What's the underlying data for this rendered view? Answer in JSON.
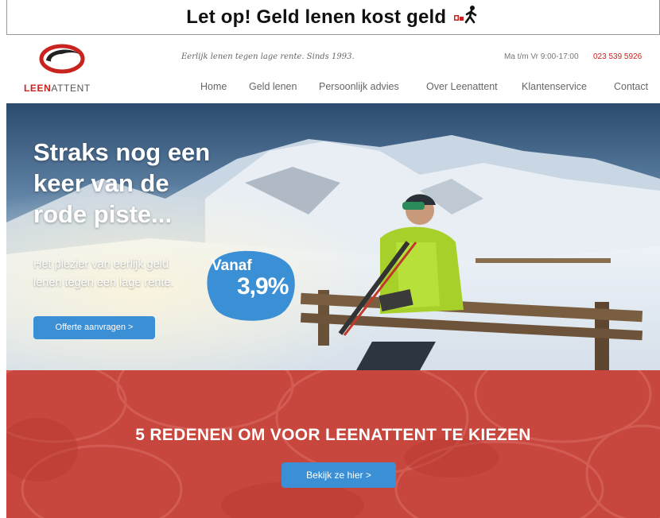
{
  "warning_banner": {
    "text": "Let op! Geld lenen kost geld"
  },
  "brand": {
    "name_part1": "LEEN",
    "name_part2": "ATTENT",
    "accent_color": "#c8231e"
  },
  "header": {
    "tagline": "Eerlijk lenen tegen lage rente. Sinds 1993.",
    "hours": "Ma t/m Vr 9:00-17:00",
    "phone": "023 539 5926"
  },
  "nav": {
    "items": [
      "Home",
      "Geld lenen",
      "Persoonlijk advies",
      "Over Leenattent",
      "Klantenservice",
      "Contact"
    ]
  },
  "hero": {
    "title_line1": "Straks nog een",
    "title_line2": "keer van de",
    "title_line3": "rode piste...",
    "subtitle_line1": "Het plezier van eerlijk geld",
    "subtitle_line2": "lenen tegen een lage rente.",
    "rate_label": "Vanaf",
    "rate_value": "3,9%",
    "cta_label": "Offerte aanvragen >"
  },
  "reasons": {
    "title": "5 REDENEN OM VOOR LEENATTENT TE KIEZEN",
    "cta_label": "Bekijk ze hier >"
  },
  "colors": {
    "button_blue": "#3b8fd4",
    "section_red": "#c7473e"
  }
}
